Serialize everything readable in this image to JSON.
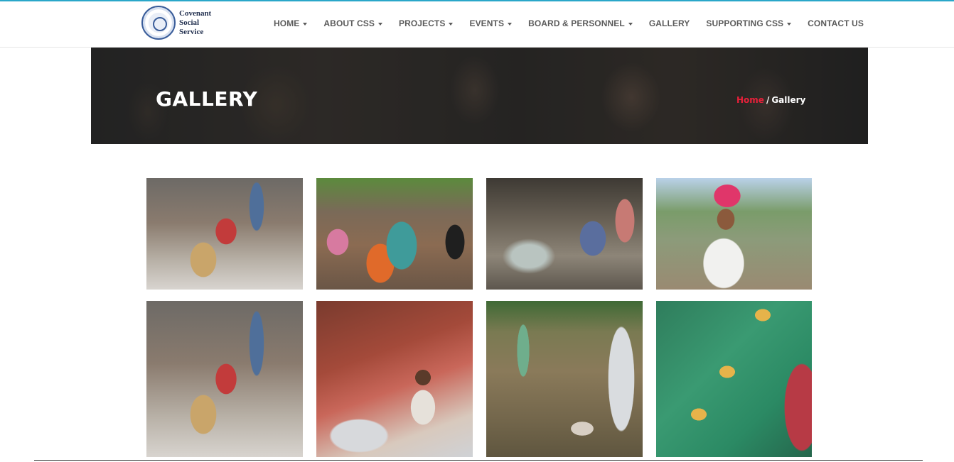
{
  "brand": {
    "logo_lines": [
      "Covenant",
      "Social",
      "Service"
    ],
    "accent_color": "#e8203a",
    "topline_color": "#2aa7c9"
  },
  "nav": {
    "items": [
      {
        "label": "HOME",
        "has_dropdown": true
      },
      {
        "label": "ABOUT CSS",
        "has_dropdown": true
      },
      {
        "label": "PROJECTS",
        "has_dropdown": true
      },
      {
        "label": "EVENTS",
        "has_dropdown": true
      },
      {
        "label": "BOARD & PERSONNEL",
        "has_dropdown": true
      },
      {
        "label": "GALLERY",
        "has_dropdown": false
      },
      {
        "label": "SUPPORTING CSS",
        "has_dropdown": true
      },
      {
        "label": "CONTACT US",
        "has_dropdown": false
      }
    ]
  },
  "banner": {
    "title": "GALLERY",
    "breadcrumb": {
      "home": "Home",
      "separator": "/",
      "current": "Gallery"
    }
  },
  "gallery": {
    "images": [
      {
        "icon": "photo-women-slum"
      },
      {
        "icon": "photo-crying-crowd"
      },
      {
        "icon": "photo-boy-garbage"
      },
      {
        "icon": "photo-man-turban"
      },
      {
        "icon": "photo-women-slum"
      },
      {
        "icon": "photo-boy-recycling"
      },
      {
        "icon": "photo-flooded-street"
      },
      {
        "icon": "photo-children-ladder"
      }
    ]
  }
}
